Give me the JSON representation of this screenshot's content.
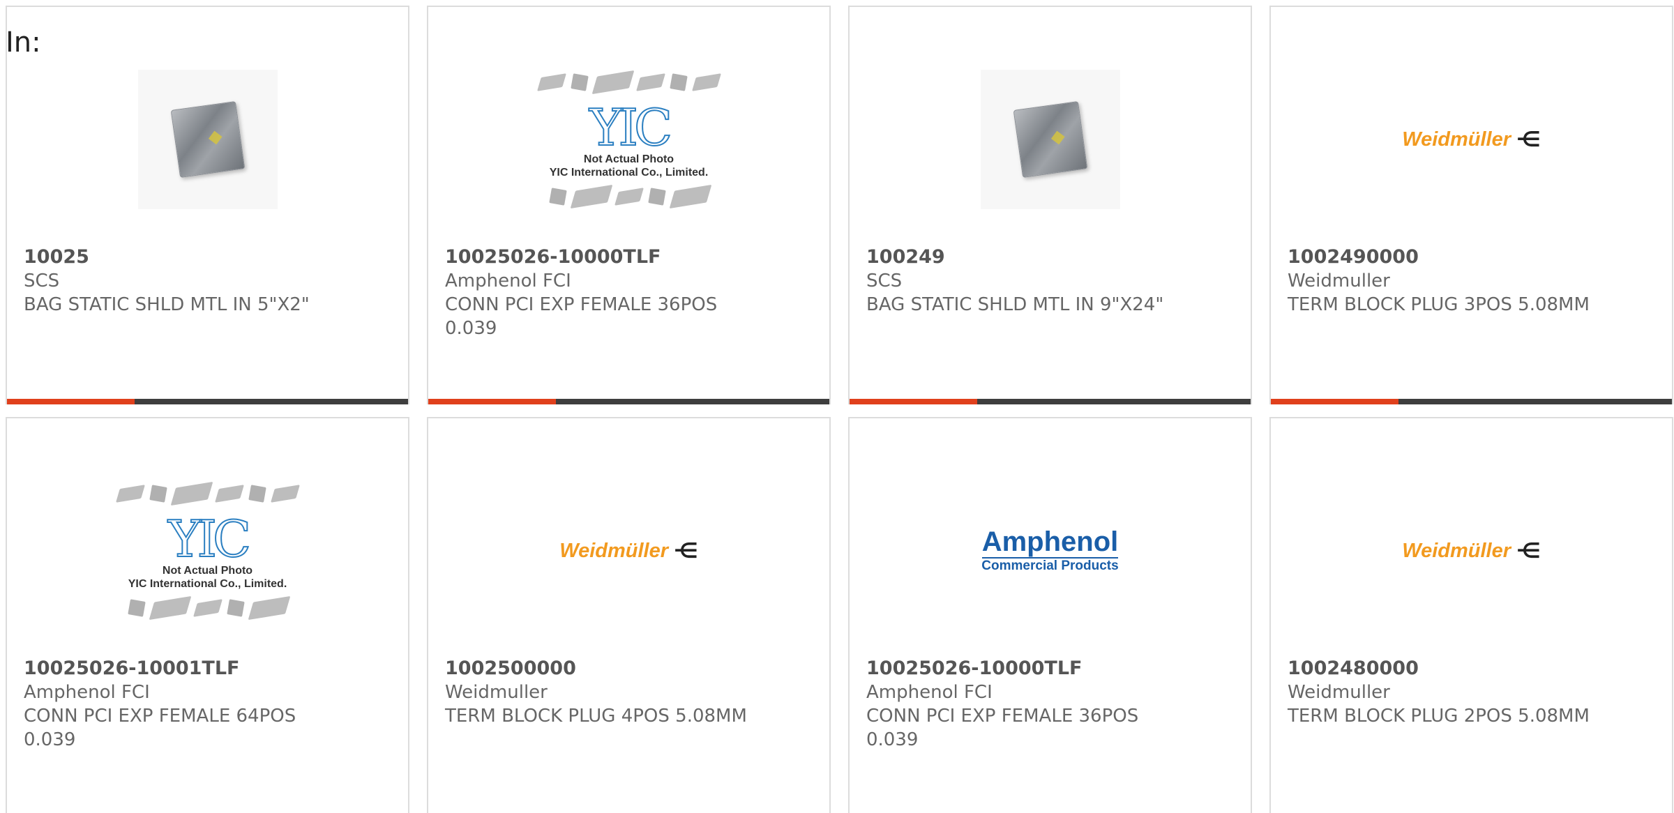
{
  "filter_label": "In:",
  "colors": {
    "accent": "#e0401c",
    "bar": "#3e3e3e",
    "weidmuller": "#f29a1f",
    "amphenol": "#1a5ea8",
    "yic": "#2b7fc1"
  },
  "placeholder_image": {
    "logo": "YIC",
    "note_line1": "Not Actual Photo",
    "note_line2": "YIC International Co., Limited."
  },
  "brand_logos": {
    "weidmuller": "Weidmüller",
    "amphenol_name": "Amphenol",
    "amphenol_sub": "Commercial Products"
  },
  "products": [
    {
      "part_number": "10025",
      "manufacturer": "SCS",
      "description": "BAG STATIC SHLD MTL IN 5\"X2\"",
      "image": "static-bag-photo"
    },
    {
      "part_number": "10025026-10000TLF",
      "manufacturer": "Amphenol FCI",
      "description": "CONN PCI EXP FEMALE 36POS 0.039",
      "image": "yic-placeholder"
    },
    {
      "part_number": "100249",
      "manufacturer": "SCS",
      "description": "BAG STATIC SHLD MTL IN 9\"X24\"",
      "image": "static-bag-photo"
    },
    {
      "part_number": "1002490000",
      "manufacturer": "Weidmuller",
      "description": "TERM BLOCK PLUG 3POS 5.08MM",
      "image": "weidmuller-logo"
    },
    {
      "part_number": "10025026-10001TLF",
      "manufacturer": "Amphenol FCI",
      "description": "CONN PCI EXP FEMALE 64POS 0.039",
      "image": "yic-placeholder"
    },
    {
      "part_number": "1002500000",
      "manufacturer": "Weidmuller",
      "description": "TERM BLOCK PLUG 4POS 5.08MM",
      "image": "weidmuller-logo"
    },
    {
      "part_number": "10025026-10000TLF",
      "manufacturer": "Amphenol FCI",
      "description": "CONN PCI EXP FEMALE 36POS 0.039",
      "image": "amphenol-logo"
    },
    {
      "part_number": "1002480000",
      "manufacturer": "Weidmuller",
      "description": "TERM BLOCK PLUG 2POS 5.08MM",
      "image": "weidmuller-logo"
    }
  ]
}
